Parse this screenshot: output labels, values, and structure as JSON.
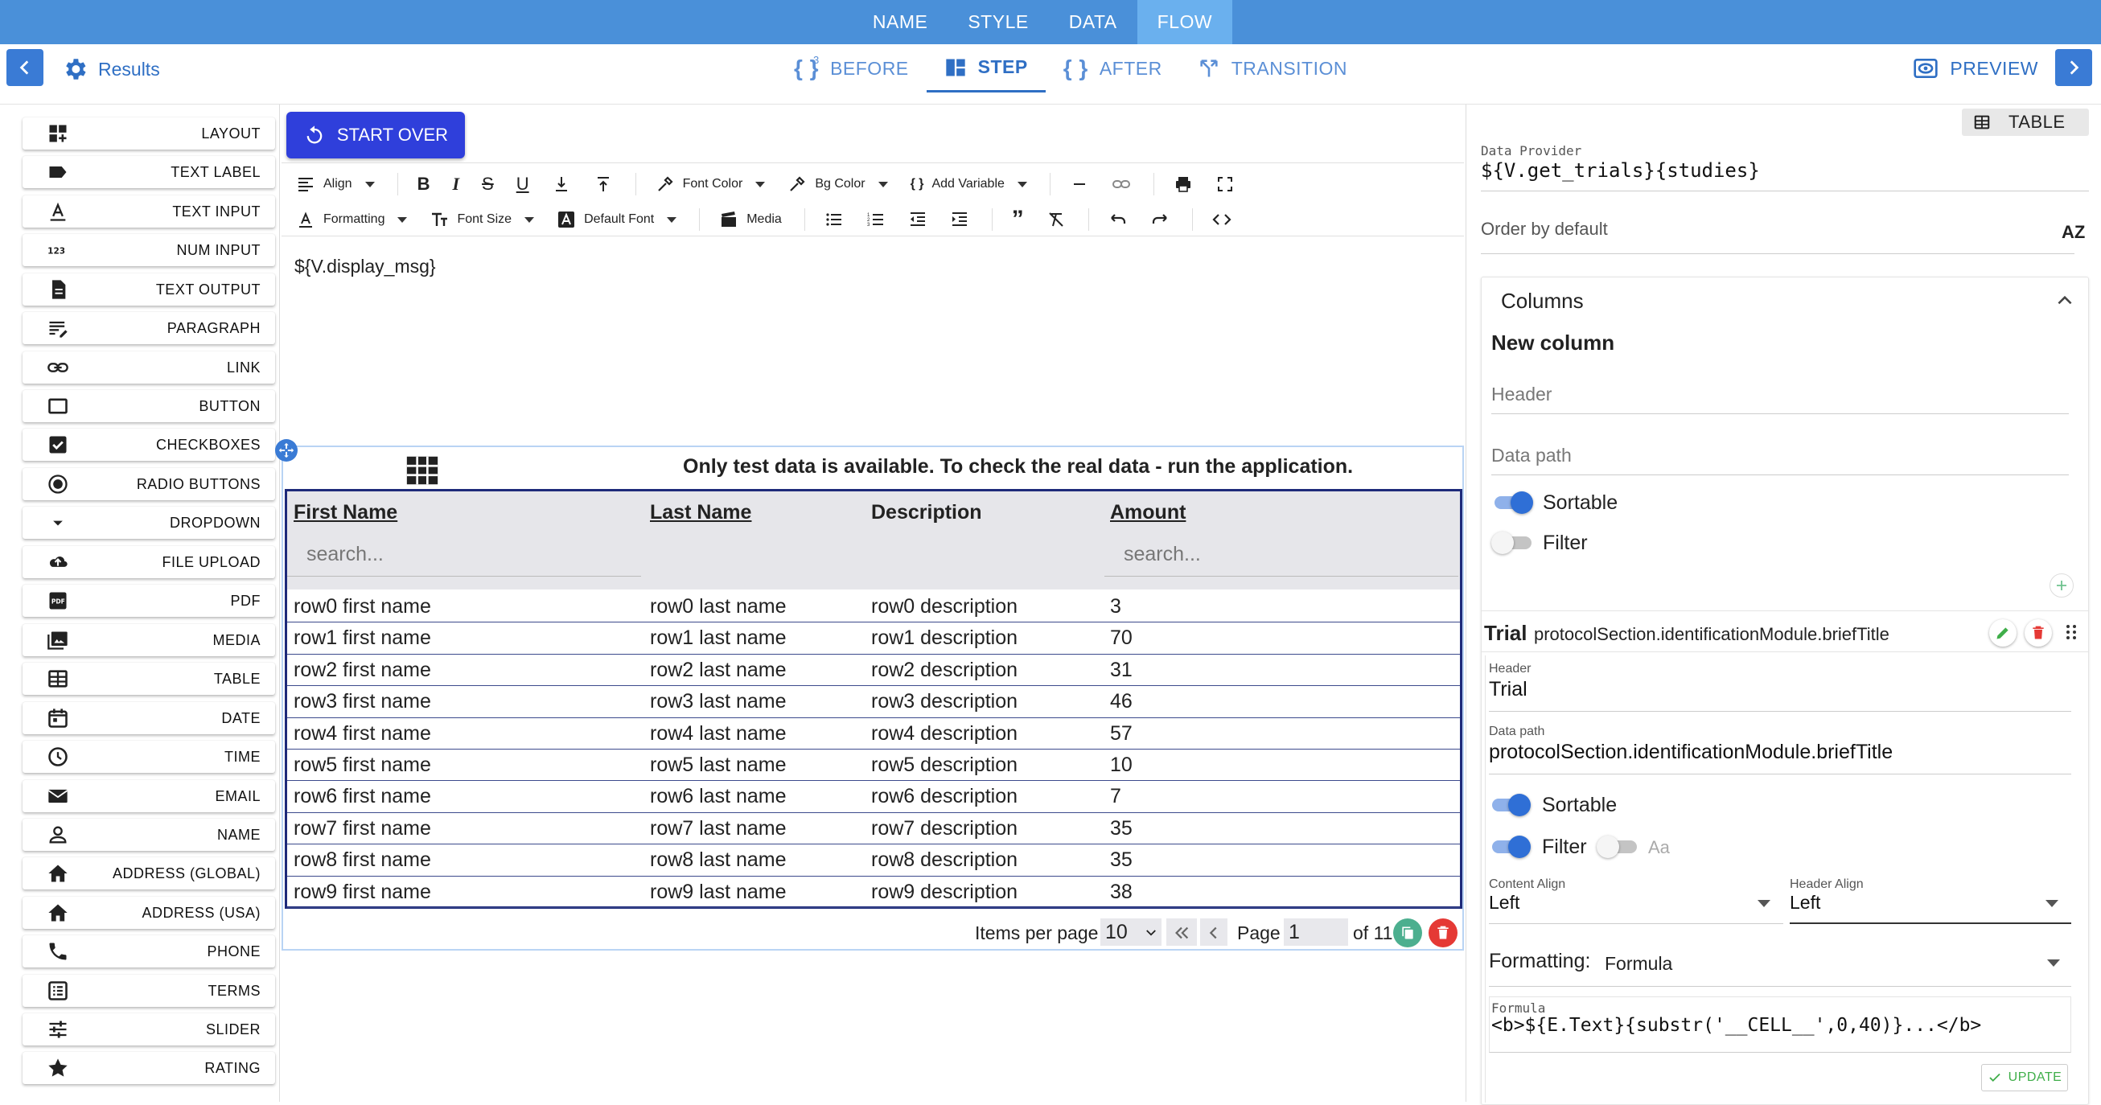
{
  "top_tabs": [
    "NAME",
    "STYLE",
    "DATA",
    "FLOW"
  ],
  "active_top_tab": "FLOW",
  "header": {
    "results_label": "Results",
    "before_label": "BEFORE",
    "before_count": "3",
    "step_label": "STEP",
    "after_label": "AFTER",
    "transition_label": "TRANSITION",
    "preview_label": "PREVIEW"
  },
  "components": [
    {
      "label": "LAYOUT",
      "icon": "layout-icon"
    },
    {
      "label": "TEXT LABEL",
      "icon": "label-icon"
    },
    {
      "label": "TEXT INPUT",
      "icon": "text-input-icon"
    },
    {
      "label": "NUM INPUT",
      "icon": "num-input-icon"
    },
    {
      "label": "TEXT OUTPUT",
      "icon": "text-output-icon"
    },
    {
      "label": "PARAGRAPH",
      "icon": "paragraph-icon"
    },
    {
      "label": "LINK",
      "icon": "link-icon"
    },
    {
      "label": "BUTTON",
      "icon": "button-icon"
    },
    {
      "label": "CHECKBOXES",
      "icon": "checkbox-icon"
    },
    {
      "label": "RADIO BUTTONS",
      "icon": "radio-icon"
    },
    {
      "label": "DROPDOWN",
      "icon": "dropdown-icon"
    },
    {
      "label": "FILE UPLOAD",
      "icon": "upload-icon"
    },
    {
      "label": "PDF",
      "icon": "pdf-icon"
    },
    {
      "label": "MEDIA",
      "icon": "media-icon"
    },
    {
      "label": "TABLE",
      "icon": "table-icon"
    },
    {
      "label": "DATE",
      "icon": "calendar-icon"
    },
    {
      "label": "TIME",
      "icon": "clock-icon"
    },
    {
      "label": "EMAIL",
      "icon": "email-icon"
    },
    {
      "label": "NAME",
      "icon": "person-icon"
    },
    {
      "label": "ADDRESS (GLOBAL)",
      "icon": "home-icon"
    },
    {
      "label": "ADDRESS (USA)",
      "icon": "home-icon"
    },
    {
      "label": "PHONE",
      "icon": "phone-icon"
    },
    {
      "label": "TERMS",
      "icon": "terms-icon"
    },
    {
      "label": "SLIDER",
      "icon": "slider-icon"
    },
    {
      "label": "RATING",
      "icon": "star-icon"
    }
  ],
  "editor": {
    "start_over_label": "START OVER",
    "toolbar": {
      "align": "Align",
      "font_color": "Font Color",
      "bg_color": "Bg Color",
      "add_variable": "Add Variable",
      "formatting": "Formatting",
      "font_size": "Font Size",
      "default_font": "Default Font",
      "media": "Media"
    },
    "content": "${V.display_msg}"
  },
  "table_preview": {
    "notice": "Only test data is available. To check the real data - run the application.",
    "columns": [
      "First Name",
      "Last Name",
      "Description",
      "Amount"
    ],
    "search_placeholder": "search...",
    "rows": [
      [
        "row0 first name",
        "row0 last name",
        "row0 description",
        "3"
      ],
      [
        "row1 first name",
        "row1 last name",
        "row1 description",
        "70"
      ],
      [
        "row2 first name",
        "row2 last name",
        "row2 description",
        "31"
      ],
      [
        "row3 first name",
        "row3 last name",
        "row3 description",
        "46"
      ],
      [
        "row4 first name",
        "row4 last name",
        "row4 description",
        "57"
      ],
      [
        "row5 first name",
        "row5 last name",
        "row5 description",
        "10"
      ],
      [
        "row6 first name",
        "row6 last name",
        "row6 description",
        "7"
      ],
      [
        "row7 first name",
        "row7 last name",
        "row7 description",
        "35"
      ],
      [
        "row8 first name",
        "row8 last name",
        "row8 description",
        "35"
      ],
      [
        "row9 first name",
        "row9 last name",
        "row9 description",
        "38"
      ]
    ],
    "pager": {
      "items_per_page_label": "Items per page",
      "items_per_page": "10",
      "page_label": "Page",
      "page": "1",
      "of_label": "of 11"
    }
  },
  "properties": {
    "type_badge": "TABLE",
    "data_provider_label": "Data Provider",
    "data_provider": "${V.get_trials}{studies}",
    "order_by_default_label": "Order by default",
    "sort_badge": "AZ",
    "columns_title": "Columns",
    "new_column": {
      "title": "New column",
      "header_placeholder": "Header",
      "data_path_placeholder": "Data path",
      "sortable_label": "Sortable",
      "filter_label": "Filter"
    },
    "column": {
      "name": "Trial",
      "path": "protocolSection.identificationModule.briefTitle",
      "header_label": "Header",
      "header": "Trial",
      "data_path_label": "Data path",
      "data_path": "protocolSection.identificationModule.briefTitle",
      "sortable_label": "Sortable",
      "filter_label": "Filter",
      "case_label": "Aa",
      "content_align_label": "Content Align",
      "content_align": "Left",
      "header_align_label": "Header Align",
      "header_align": "Left",
      "formatting_label": "Formatting:",
      "formatting": "Formula",
      "formula_label": "Formula",
      "formula": "<b>${E.Text}{substr('__CELL__',0,40)}...</b>",
      "update_label": "UPDATE"
    }
  },
  "colors": {
    "topbar": "#4a90d9",
    "accent": "#2f6fc4",
    "toggle_on": "#2f6fd6",
    "table_border": "#1e2a7a"
  }
}
